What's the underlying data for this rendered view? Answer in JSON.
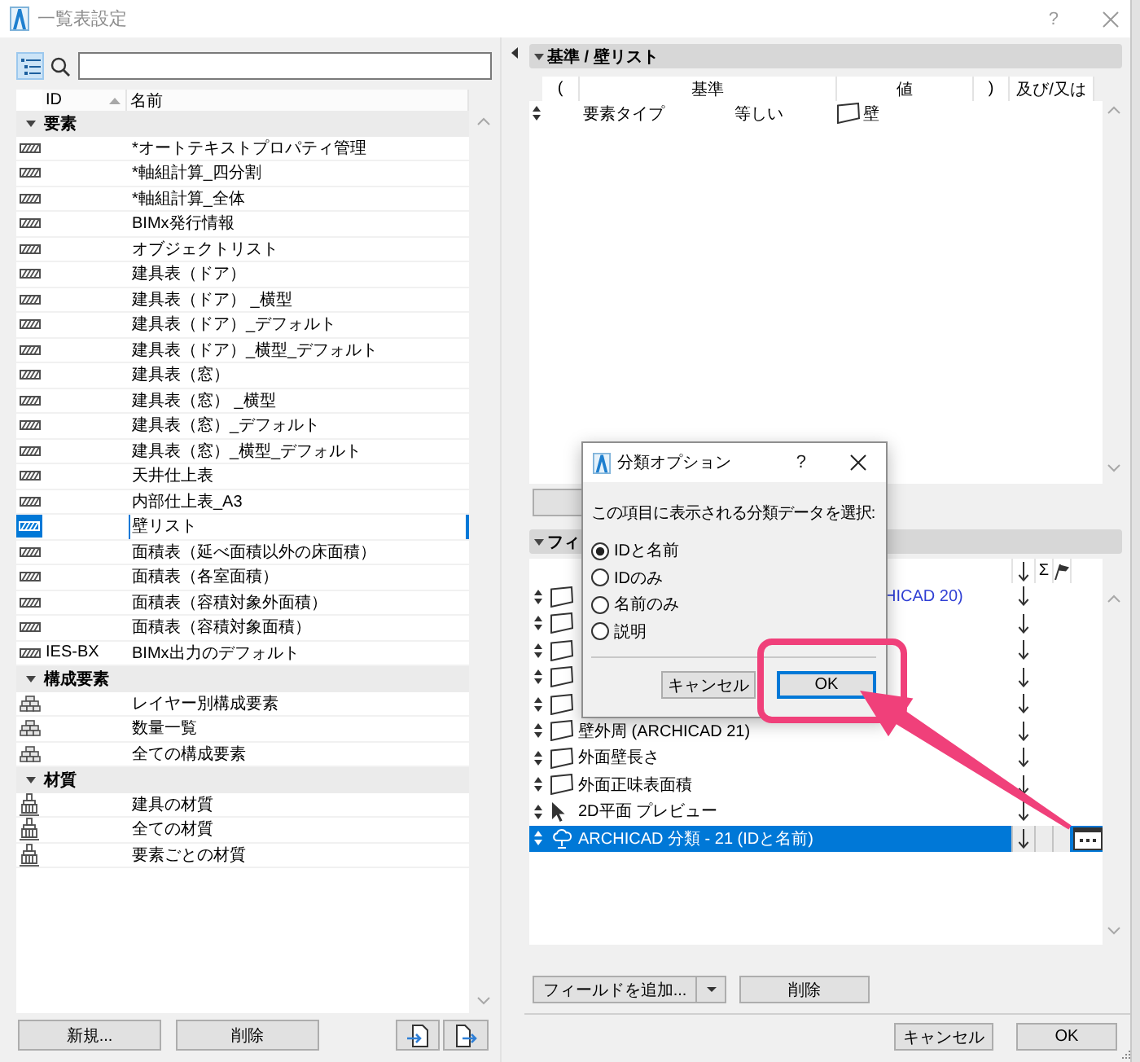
{
  "window": {
    "title": "一覧表設定",
    "help": "?"
  },
  "sidebar": {
    "view_toggle": {
      "selected": true
    },
    "columns": [
      "ID",
      "名前"
    ],
    "groups": [
      {
        "label": "要素",
        "kind": "element",
        "expanded": true,
        "children": [
          {
            "name": "*オートテキストプロパティ管理",
            "selected": false
          },
          {
            "name": "*軸組計算_四分割",
            "selected": false
          },
          {
            "name": "*軸組計算_全体",
            "selected": false
          },
          {
            "name": "BIMx発行情報",
            "selected": false
          },
          {
            "name": "オブジェクトリスト",
            "selected": false
          },
          {
            "name": "建具表（ドア）",
            "selected": false
          },
          {
            "name": "建具表（ドア） _横型",
            "selected": false
          },
          {
            "name": "建具表（ドア）_デフォルト",
            "selected": false
          },
          {
            "name": "建具表（ドア）_横型_デフォルト",
            "selected": false
          },
          {
            "name": "建具表（窓）",
            "selected": false
          },
          {
            "name": "建具表（窓） _横型",
            "selected": false
          },
          {
            "name": "建具表（窓）_デフォルト",
            "selected": false
          },
          {
            "name": "建具表（窓）_横型_デフォルト",
            "selected": false
          },
          {
            "name": "天井仕上表",
            "selected": false
          },
          {
            "name": "内部仕上表_A3",
            "selected": false
          },
          {
            "name": "壁リスト",
            "selected": true
          },
          {
            "name": "面積表（延べ面積以外の床面積）",
            "selected": false
          },
          {
            "name": "面積表（各室面積）",
            "selected": false
          },
          {
            "name": "面積表（容積対象外面積）",
            "selected": false
          },
          {
            "name": "面積表（容積対象面積）",
            "selected": false
          },
          {
            "id": "IES-BX",
            "name": "BIMx出力のデフォルト",
            "selected": false
          }
        ]
      },
      {
        "label": "構成要素",
        "kind": "component",
        "expanded": true,
        "children": [
          {
            "name": "レイヤー別構成要素",
            "selected": false
          },
          {
            "name": "数量一覧",
            "selected": false
          },
          {
            "name": "全ての構成要素",
            "selected": false
          }
        ]
      },
      {
        "label": "材質",
        "kind": "material",
        "expanded": true,
        "children": [
          {
            "name": "建具の材質",
            "selected": false
          },
          {
            "name": "全ての材質",
            "selected": false
          },
          {
            "name": "要素ごとの材質",
            "selected": false
          }
        ]
      }
    ],
    "buttons": [
      "新規...",
      "削除"
    ]
  },
  "criteria": {
    "title": "基準 / 壁リスト",
    "expanded": true,
    "columns": [
      "(",
      "基準",
      "値",
      ")",
      "及び/又は"
    ],
    "rows": [
      {
        "property": "要素タイプ",
        "operator": "等しい",
        "value": "壁"
      }
    ]
  },
  "fields": {
    "title": "フィ",
    "expanded": true,
    "sum_header": "Σ",
    "rows": [
      {
        "kind": "wall",
        "name": "HICAD 20)",
        "color": "#2f3fd4",
        "covered": true,
        "selected": false
      },
      {
        "kind": "wall",
        "selected": false
      },
      {
        "kind": "wall",
        "selected": false
      },
      {
        "kind": "wall",
        "selected": false
      },
      {
        "kind": "wall",
        "selected": false
      },
      {
        "kind": "wall",
        "name": "壁外周 (ARCHICAD 21)",
        "color": "#000000",
        "selected": false
      },
      {
        "kind": "wall",
        "name": "外面壁長さ",
        "color": "#000000",
        "selected": false
      },
      {
        "kind": "wall",
        "name": "外面正味表面積",
        "color": "#000000",
        "selected": false
      },
      {
        "kind": "pointer",
        "name": "2D平面 プレビュー",
        "color": "#000000",
        "selected": false
      },
      {
        "kind": "classification",
        "name": "ARCHICAD 分類 - 21 (IDと名前)",
        "selected": true
      }
    ],
    "add_button": "フィールドを追加...",
    "delete_button": "削除"
  },
  "dialog": {
    "title": "分類オプション",
    "help": "?",
    "prompt": "この項目に表示される分類データを選択:",
    "options": [
      {
        "label": "IDと名前",
        "selected": true
      },
      {
        "label": "IDのみ",
        "selected": false
      },
      {
        "label": "名前のみ",
        "selected": false
      },
      {
        "label": "説明",
        "selected": false
      }
    ],
    "buttons": [
      {
        "label": "キャンセル",
        "default": false
      },
      {
        "label": "OK",
        "default": true
      }
    ]
  },
  "footer": {
    "buttons": [
      "キャンセル",
      "OK"
    ]
  }
}
